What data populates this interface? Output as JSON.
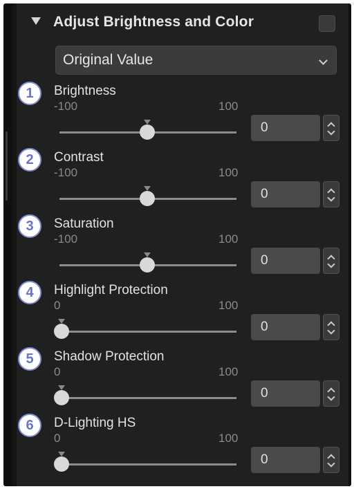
{
  "panel": {
    "title": "Adjust Brightness and Color",
    "preset": {
      "selected": "Original Value"
    }
  },
  "sliders": [
    {
      "badge": "1",
      "label": "Brightness",
      "min": "-100",
      "max": "100",
      "value": "0",
      "level": 0.5
    },
    {
      "badge": "2",
      "label": "Contrast",
      "min": "-100",
      "max": "100",
      "value": "0",
      "level": 0.5
    },
    {
      "badge": "3",
      "label": "Saturation",
      "min": "-100",
      "max": "100",
      "value": "0",
      "level": 0.5
    },
    {
      "badge": "4",
      "label": "Highlight Protection",
      "min": "0",
      "max": "100",
      "value": "0",
      "level": 0.0
    },
    {
      "badge": "5",
      "label": "Shadow Protection",
      "min": "0",
      "max": "100",
      "value": "0",
      "level": 0.0
    },
    {
      "badge": "6",
      "label": "D-Lighting HS",
      "min": "0",
      "max": "100",
      "value": "0",
      "level": 0.0
    }
  ],
  "icons": {
    "collapse": "triangle-down-icon",
    "dropdown": "chevron-down-icon",
    "spinner": "up-down-arrows-icon"
  },
  "colors": {
    "panel_bg": "#202020",
    "badge_ring": "#7f8bd6",
    "badge_text": "#6a74c6"
  }
}
